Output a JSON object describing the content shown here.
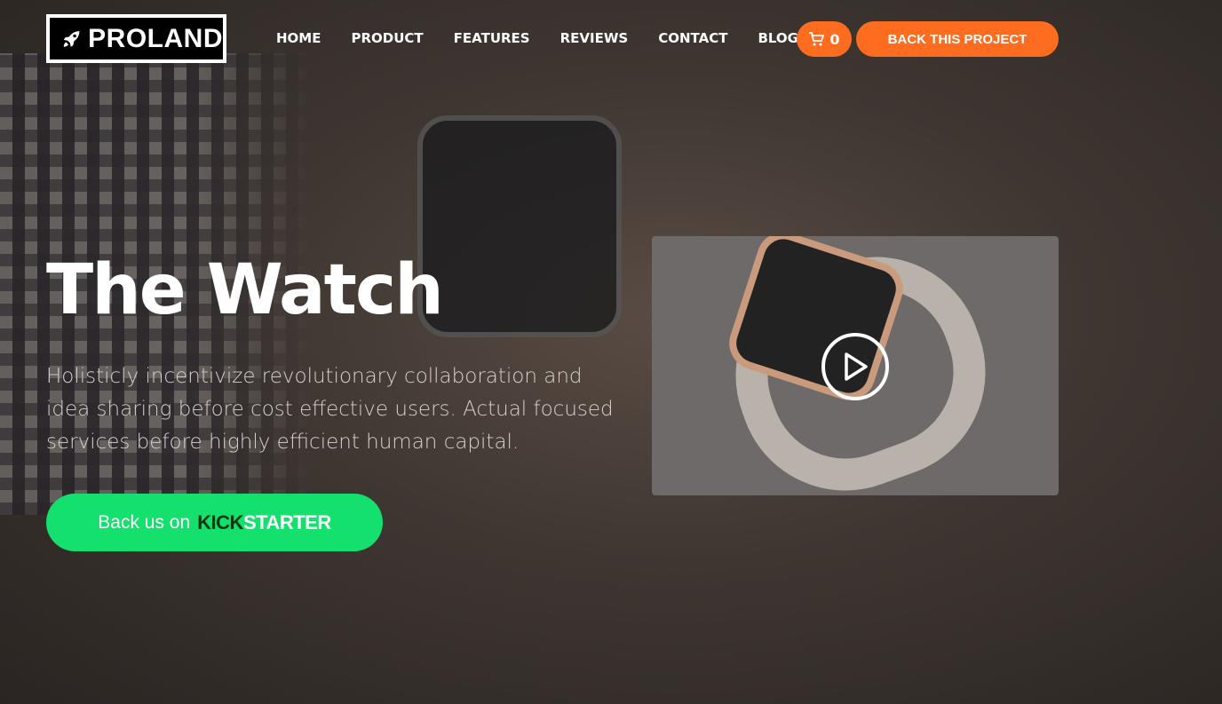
{
  "brand": {
    "name": "PROLAND"
  },
  "nav": {
    "items": [
      "HOME",
      "PRODUCT",
      "FEATURES",
      "REVIEWS",
      "CONTACT",
      "BLOG"
    ]
  },
  "cart": {
    "count": "0"
  },
  "cta": {
    "back_project": "BACK THIS PROJECT"
  },
  "colors": {
    "accent": "#fe6c1f",
    "kickstarter": "#14e06e"
  },
  "hero": {
    "title": "The Watch",
    "description": "Holisticly incentivize revolutionary collaboration and idea sharing before cost effective users. Actual focused services before highly efficient human capital.",
    "kickstarter_prefix": "Back us on",
    "kickstarter_kick": "KICK",
    "kickstarter_starter": "STARTER"
  }
}
